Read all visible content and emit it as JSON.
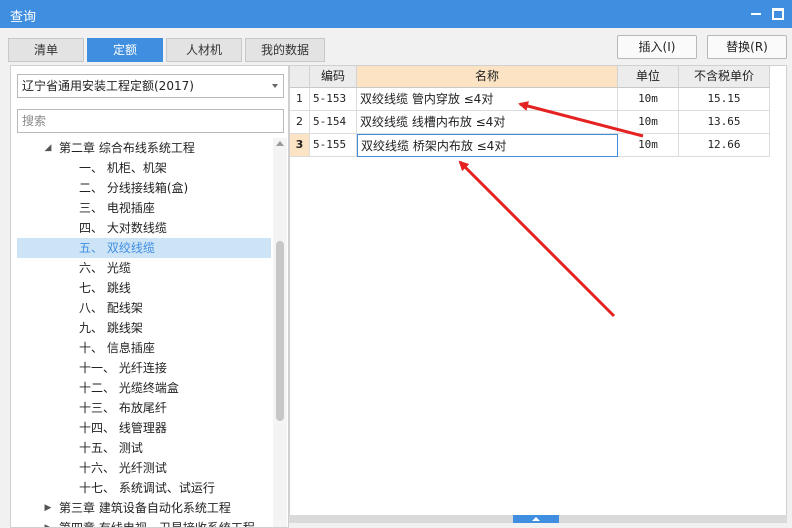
{
  "window": {
    "title": "查询",
    "accent": "#3f8ee0"
  },
  "tabs": [
    {
      "label": "清单",
      "active": false
    },
    {
      "label": "定额",
      "active": true
    },
    {
      "label": "人材机",
      "active": false
    },
    {
      "label": "我的数据",
      "active": false
    }
  ],
  "actions": {
    "insert_label": "插入(I)",
    "replace_label": "替换(R)"
  },
  "left": {
    "quota_select": "辽宁省通用安装工程定额(2017)",
    "search_placeholder": "搜索",
    "tree": [
      {
        "label": "第二章 综合布线系统工程",
        "level": 1,
        "expanded": true
      },
      {
        "label": "一、 机柜、机架",
        "level": 2
      },
      {
        "label": "二、 分线接线箱(盒)",
        "level": 2
      },
      {
        "label": "三、 电视插座",
        "level": 2
      },
      {
        "label": "四、 大对数线缆",
        "level": 2
      },
      {
        "label": "五、 双绞线缆",
        "level": 2,
        "selected": true
      },
      {
        "label": "六、 光缆",
        "level": 2
      },
      {
        "label": "七、 跳线",
        "level": 2
      },
      {
        "label": "八、 配线架",
        "level": 2
      },
      {
        "label": "九、 跳线架",
        "level": 2
      },
      {
        "label": "十、 信息插座",
        "level": 2
      },
      {
        "label": "十一、 光纤连接",
        "level": 2
      },
      {
        "label": "十二、 光缆终端盒",
        "level": 2
      },
      {
        "label": "十三、 布放尾纤",
        "level": 2
      },
      {
        "label": "十四、 线管理器",
        "level": 2
      },
      {
        "label": "十五、 测试",
        "level": 2
      },
      {
        "label": "十六、 光纤测试",
        "level": 2
      },
      {
        "label": "十七、 系统调试、试运行",
        "level": 2
      },
      {
        "label": "第三章 建筑设备自动化系统工程",
        "level": 1,
        "expanded": false
      },
      {
        "label": "第四章 有线电视、卫星接收系统工程",
        "level": 1,
        "expanded": false
      }
    ]
  },
  "grid": {
    "headers": {
      "code": "编码",
      "name": "名称",
      "unit": "单位",
      "price": "不含税单价"
    },
    "rows": [
      {
        "idx": "1",
        "code": "5-153",
        "name": "双绞线缆 管内穿放 ≤4对",
        "unit": "10m",
        "price": "15.15"
      },
      {
        "idx": "2",
        "code": "5-154",
        "name": "双绞线缆 线槽内布放 ≤4对",
        "unit": "10m",
        "price": "13.65"
      },
      {
        "idx": "3",
        "code": "5-155",
        "name": "双绞线缆 桥架内布放 ≤4对",
        "unit": "10m",
        "price": "12.66",
        "current": true
      }
    ]
  },
  "annotation_color": "#e52222"
}
